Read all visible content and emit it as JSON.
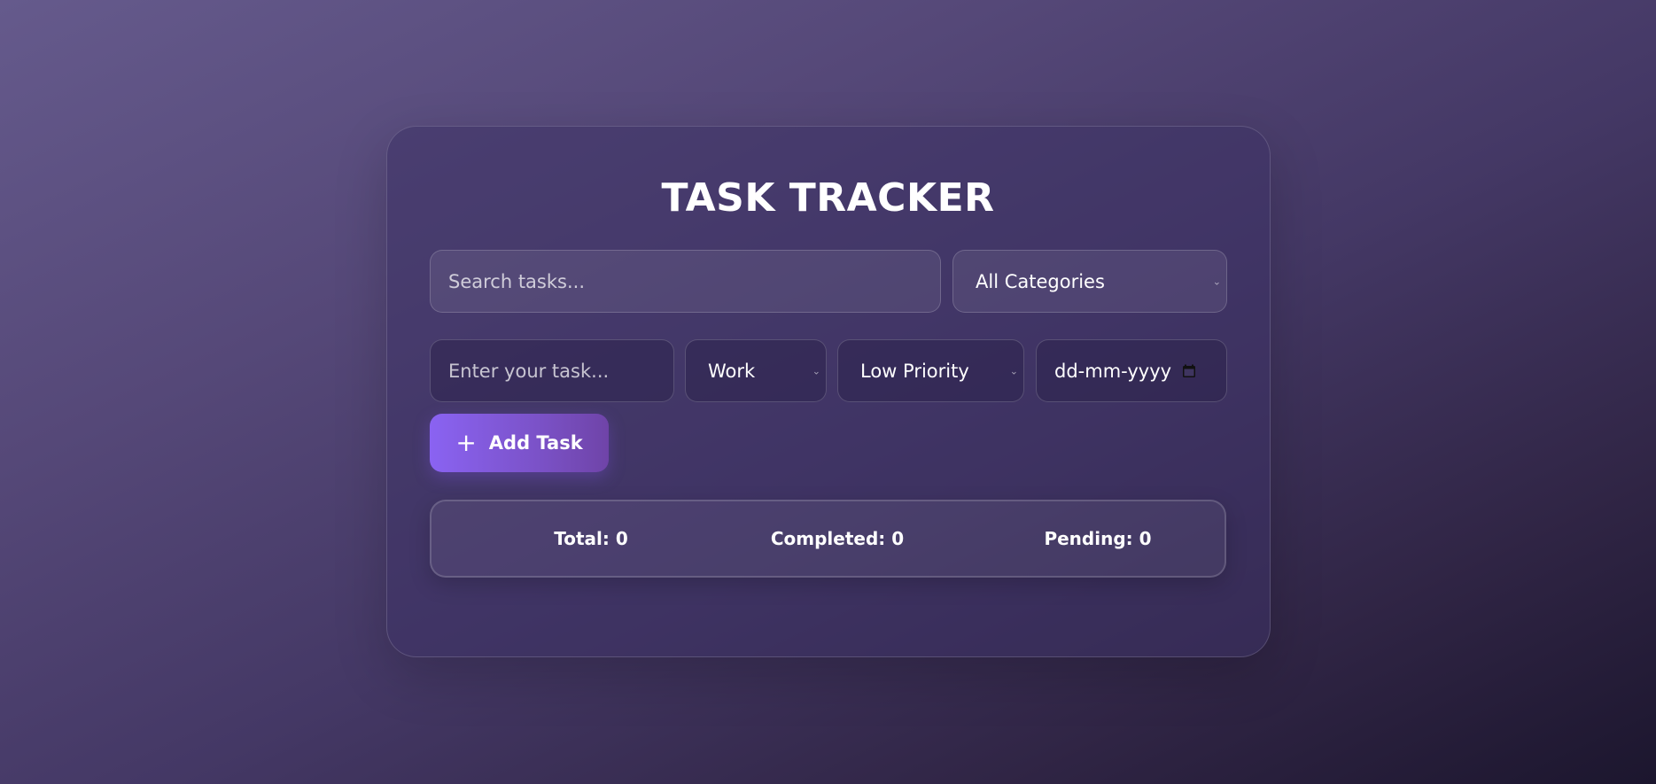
{
  "app": {
    "title": "TASK TRACKER"
  },
  "filters": {
    "search_placeholder": "Search tasks...",
    "category_selected": "All Categories"
  },
  "new_task": {
    "task_placeholder": "Enter your task...",
    "category_selected": "Work",
    "priority_selected": "Low Priority",
    "date_placeholder": "dd-mm-yyyy",
    "add_label": "Add Task",
    "add_icon": "plus-icon"
  },
  "stats": {
    "total": "Total: 0",
    "completed": "Completed: 0",
    "pending": "Pending: 0"
  },
  "colors": {
    "accent": "#8a63f2",
    "text": "#ffffff"
  }
}
